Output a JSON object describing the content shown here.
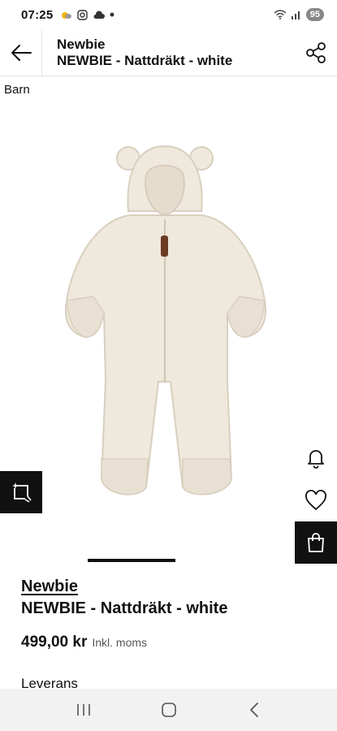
{
  "status_bar": {
    "time": "07:25",
    "battery": "95"
  },
  "header": {
    "brand": "Newbie",
    "product_name": "NEWBIE - Nattdräkt - white"
  },
  "category": "Barn",
  "product": {
    "brand": "Newbie",
    "name": "NEWBIE - Nattdräkt - white",
    "price": "499,00 kr",
    "vat_note": "Inkl. moms",
    "image_alt": "Cream sherpa pram suit with hood and bear ears"
  },
  "sections": {
    "delivery": "Leverans"
  },
  "icons": {
    "back": "arrow-left-icon",
    "share": "share-icon",
    "try_on": "sparkle-crop-icon",
    "notify": "bell-icon",
    "favorite": "heart-icon",
    "bag": "shopping-bag-icon"
  }
}
